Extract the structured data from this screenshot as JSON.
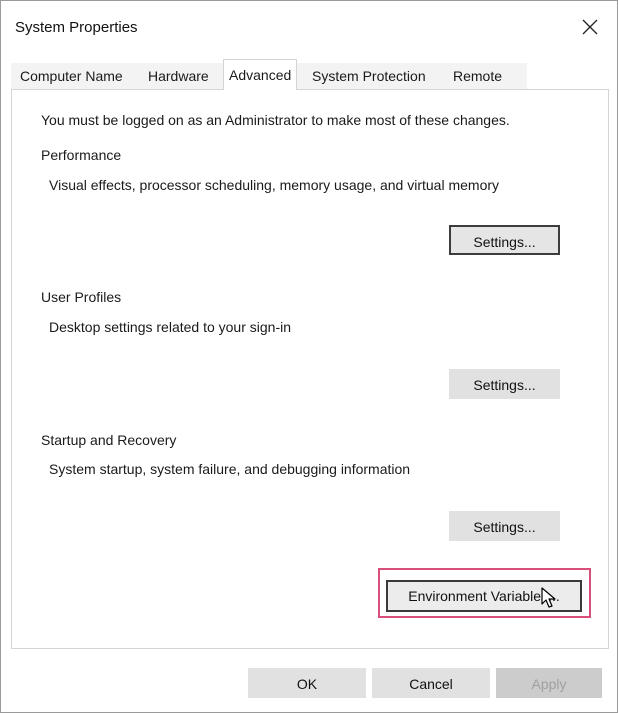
{
  "window": {
    "title": "System Properties"
  },
  "tabs": [
    {
      "label": "Computer Name",
      "active": false
    },
    {
      "label": "Hardware",
      "active": false
    },
    {
      "label": "Advanced",
      "active": true
    },
    {
      "label": "System Protection",
      "active": false
    },
    {
      "label": "Remote",
      "active": false
    }
  ],
  "advanced": {
    "admin_notice": "You must be logged on as an Administrator to make most of these changes.",
    "performance": {
      "heading": "Performance",
      "description": "Visual effects, processor scheduling, memory usage, and virtual memory",
      "settings_label": "Settings..."
    },
    "user_profiles": {
      "heading": "User Profiles",
      "description": "Desktop settings related to your sign-in",
      "settings_label": "Settings..."
    },
    "startup_recovery": {
      "heading": "Startup and Recovery",
      "description": "System startup, system failure, and debugging information",
      "settings_label": "Settings..."
    },
    "env_vars_label": "Environment Variables..."
  },
  "footer": {
    "ok_label": "OK",
    "cancel_label": "Cancel",
    "apply_label": "Apply"
  },
  "icons": {
    "close": "close-icon",
    "cursor": "mouse-pointer-icon"
  },
  "colors": {
    "highlight_frame": "#d84f7a",
    "button_bg": "#e1e1e1",
    "disabled_text": "#a0a0a0"
  }
}
